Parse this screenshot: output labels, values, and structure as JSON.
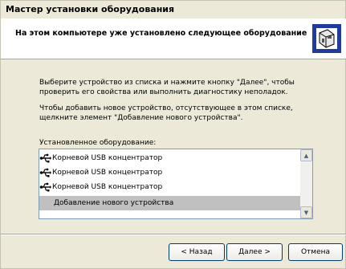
{
  "window": {
    "title": "Мастер установки оборудования"
  },
  "header": {
    "title": "На этом компьютере уже установлено следующее оборудование"
  },
  "body": {
    "paragraph1": "Выберите устройство из списка и нажмите кнопку \"Далее\", чтобы проверить его свойства или выполнить диагностику неполадок.",
    "paragraph2": "Чтобы добавить новое устройство, отсутствующее в этом списке, щелкните элемент \"Добавление нового устройства\".",
    "list_label": "Установленное оборудование:"
  },
  "device_list": {
    "items": [
      {
        "label": "Корневой USB концентратор",
        "icon": "usb-icon"
      },
      {
        "label": "Корневой USB концентратор",
        "icon": "usb-icon"
      },
      {
        "label": "Корневой USB концентратор",
        "icon": "usb-icon"
      },
      {
        "label": "Добавление нового устройства",
        "selected": true
      }
    ]
  },
  "buttons": {
    "back": "< Назад",
    "next": "Далее >",
    "cancel": "Отмена"
  },
  "icons": {
    "wizard": "hardware-wizard-icon",
    "scroll_up": "scroll-up-arrow-icon",
    "scroll_down": "scroll-down-arrow-icon"
  }
}
